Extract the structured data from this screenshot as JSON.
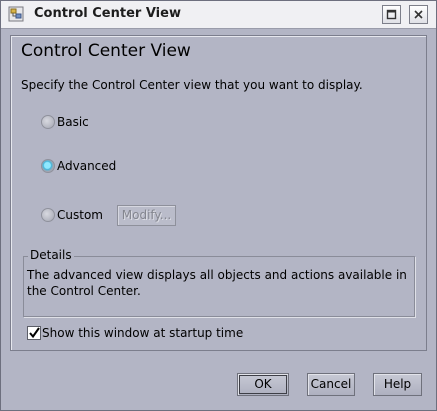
{
  "window": {
    "title": "Control Center View",
    "icons": [
      "app-icon",
      "maximize-icon",
      "close-icon"
    ]
  },
  "main": {
    "heading": "Control Center View",
    "instructions": "Specify the Control Center view that you want to display.",
    "view_options": [
      {
        "label": "Basic",
        "selected": false
      },
      {
        "label": "Advanced",
        "selected": true
      },
      {
        "label": "Custom",
        "selected": false
      }
    ],
    "modify_button_label": "Modify...",
    "details": {
      "legend": "Details",
      "text": "The advanced view displays all objects and actions available in the Control Center."
    },
    "startup_checkbox": {
      "label": "Show this window at startup time",
      "checked": true
    }
  },
  "footer": {
    "ok_label": "OK",
    "cancel_label": "Cancel",
    "help_label": "Help"
  },
  "colors": {
    "background": "#b3b5c5",
    "selected_radio": "#44b7db"
  }
}
